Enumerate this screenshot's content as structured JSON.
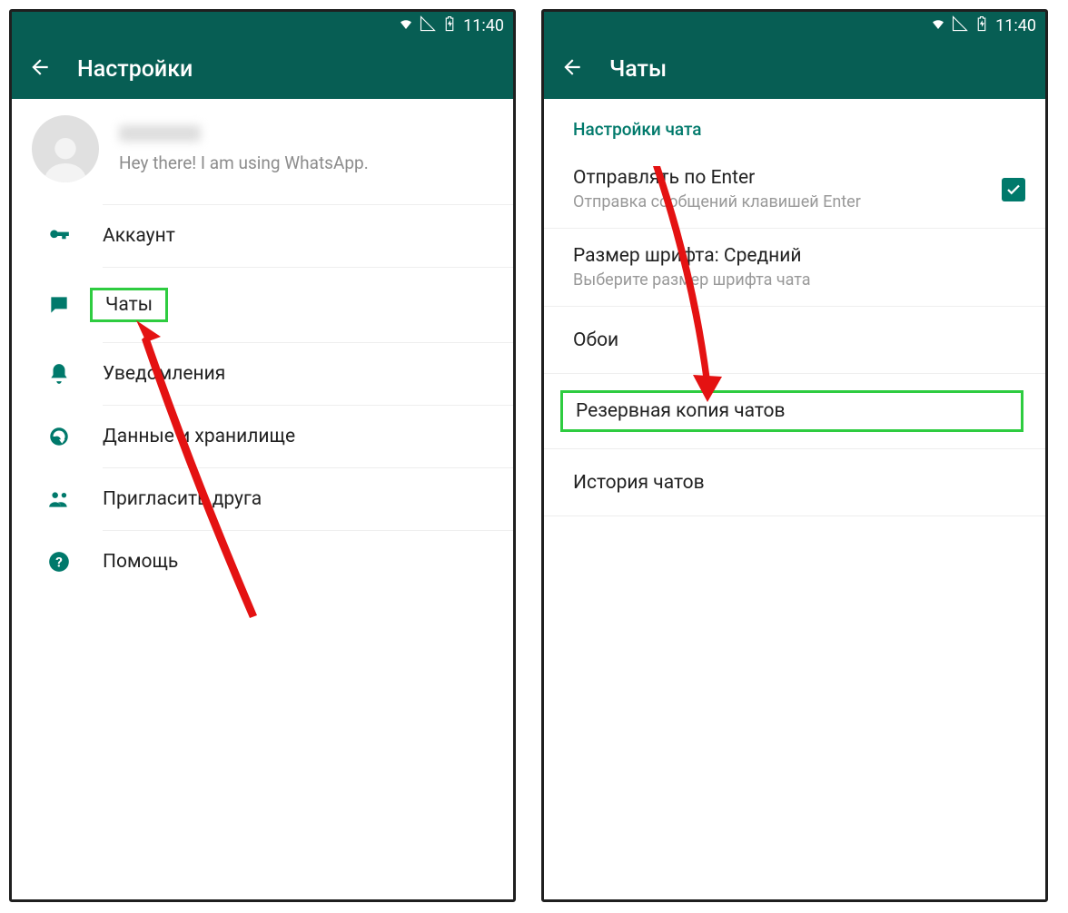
{
  "colors": {
    "brand": "#075E54",
    "accent": "#00796b",
    "highlight": "#2ecc40",
    "annotation_arrow": "#e41212"
  },
  "status_bar": {
    "time": "11:40"
  },
  "left_screen": {
    "title": "Настройки",
    "profile": {
      "name": "(blurred)",
      "status": "Hey there! I am using WhatsApp."
    },
    "menu": [
      {
        "id": "account",
        "label": "Аккаунт",
        "icon": "key-icon"
      },
      {
        "id": "chats",
        "label": "Чаты",
        "icon": "chat-icon",
        "highlighted": true
      },
      {
        "id": "notifications",
        "label": "Уведомления",
        "icon": "bell-icon"
      },
      {
        "id": "data",
        "label": "Данные и хранилище",
        "icon": "data-icon"
      },
      {
        "id": "invite",
        "label": "Пригласить друга",
        "icon": "invite-icon"
      },
      {
        "id": "help",
        "label": "Помощь",
        "icon": "help-icon"
      }
    ]
  },
  "right_screen": {
    "title": "Чаты",
    "section_header": "Настройки чата",
    "items": [
      {
        "id": "enter_send",
        "title": "Отправлять по Enter",
        "subtitle": "Отправка сообщений клавишей Enter",
        "checked": true
      },
      {
        "id": "font_size",
        "title": "Размер шрифта: Средний",
        "subtitle": "Выберите размер шрифта чата"
      },
      {
        "id": "wallpaper",
        "title": "Обои"
      },
      {
        "id": "backup",
        "title": "Резервная копия чатов",
        "highlighted": true
      },
      {
        "id": "history",
        "title": "История чатов"
      }
    ]
  }
}
